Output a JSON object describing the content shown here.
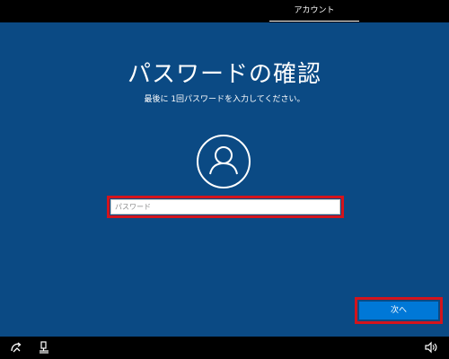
{
  "top_bar": {
    "active_tab": "アカウント"
  },
  "page": {
    "title": "パスワードの確認",
    "subtitle": "最後に 1回パスワードを入力してください。"
  },
  "password_field": {
    "placeholder": "パスワード",
    "value": ""
  },
  "next_button": {
    "label": "次へ"
  },
  "bottom_bar": {
    "icons": [
      "ease-of-access-icon",
      "network-icon",
      "speaker-icon"
    ]
  },
  "colors": {
    "background": "#0b4a84",
    "bar": "#000000",
    "accent_button": "#0078d7",
    "highlight": "#d4141c"
  }
}
